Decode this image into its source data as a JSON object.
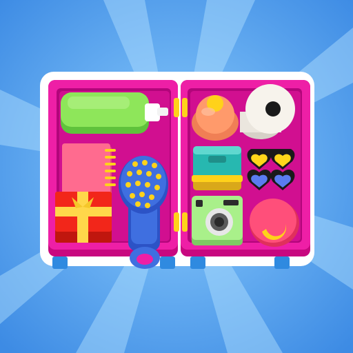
{
  "game": {
    "scene": "organizer-box-puzzle",
    "background_colors": {
      "center": "#7fc4fb",
      "edge": "#3f8fe6",
      "rays": "#a9dcff"
    },
    "box_color": "#ee1fa6",
    "box_outline_color": "#ffffff",
    "items": [
      {
        "name": "green-shampoo-bottle",
        "color": "#8ee65a"
      },
      {
        "name": "orange-spray-bottle",
        "color": "#ff9a6b"
      },
      {
        "name": "toilet-paper-roll",
        "color": "#f7f3ec"
      },
      {
        "name": "pink-notebook",
        "color": "#ff6b8f"
      },
      {
        "name": "red-gift-box",
        "color": "#f2261a"
      },
      {
        "name": "blue-hairbrush",
        "color": "#3f6fe0"
      },
      {
        "name": "teal-jewelry-box",
        "color": "#27b8b0"
      },
      {
        "name": "heart-sunglasses",
        "color": "#ffd61a"
      },
      {
        "name": "green-instant-camera",
        "color": "#a9f08a"
      },
      {
        "name": "pink-sun-hat",
        "color": "#ff4f7a"
      }
    ]
  }
}
